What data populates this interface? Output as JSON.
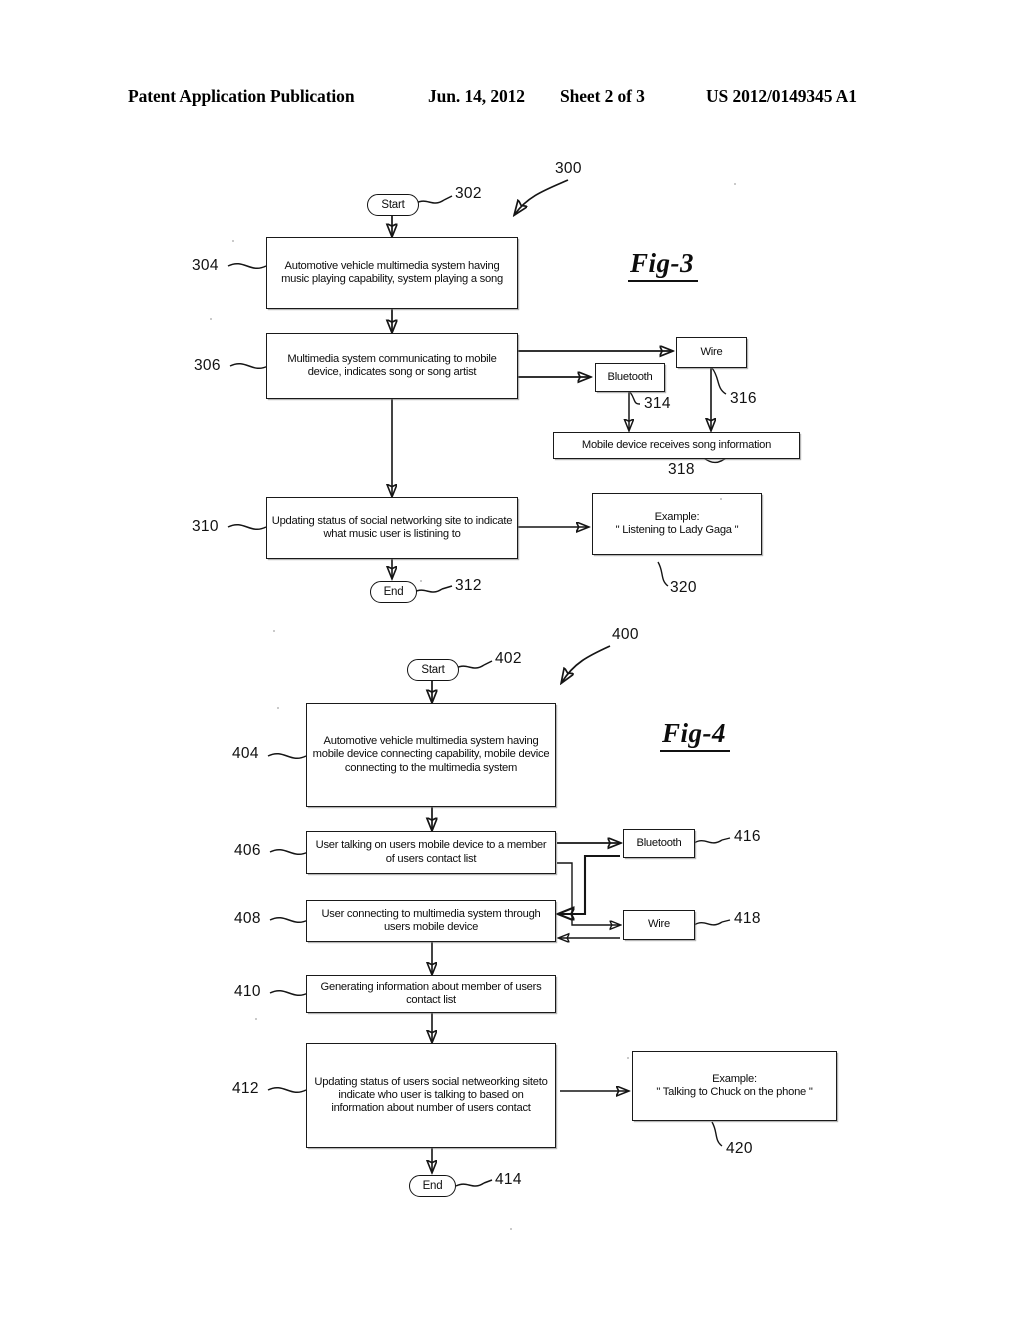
{
  "header": {
    "publication": "Patent Application Publication",
    "date": "Jun. 14, 2012",
    "sheet": "Sheet 2 of 3",
    "patent_number": "US 2012/0149345 A1"
  },
  "figures": [
    {
      "id": "fig-3",
      "label": "Fig-3",
      "diagram_ref": "300",
      "nodes": [
        {
          "ref": "302",
          "shape": "terminal",
          "text": "Start"
        },
        {
          "ref": "304",
          "shape": "process",
          "text": "Automotive vehicle multimedia system having music playing capability, system playing a song"
        },
        {
          "ref": "306",
          "shape": "process",
          "text": "Multimedia system communicating to mobile device, indicates song or song artist"
        },
        {
          "ref": "314",
          "shape": "process",
          "text": "Bluetooth"
        },
        {
          "ref": "316",
          "shape": "process",
          "text": "Wire"
        },
        {
          "ref": "318",
          "shape": "process",
          "text": "Mobile device receives song information"
        },
        {
          "ref": "310",
          "shape": "process",
          "text": "Updating status of social networking site to indicate what music user is listining to"
        },
        {
          "ref": "312",
          "shape": "terminal",
          "text": "End"
        },
        {
          "ref": "320",
          "shape": "process",
          "text": "Example: \" Listening to Lady Gaga \""
        }
      ]
    },
    {
      "id": "fig-4",
      "label": "Fig-4",
      "diagram_ref": "400",
      "nodes": [
        {
          "ref": "402",
          "shape": "terminal",
          "text": "Start"
        },
        {
          "ref": "404",
          "shape": "process",
          "text": "Automotive vehicle multimedia system having mobile device connecting capability, mobile device connecting to the multimedia system"
        },
        {
          "ref": "406",
          "shape": "process",
          "text": "User talking on users mobile device to a member of users contact list"
        },
        {
          "ref": "416",
          "shape": "process",
          "text": "Bluetooth"
        },
        {
          "ref": "408",
          "shape": "process",
          "text": "User connecting to multimedia system through users mobile device"
        },
        {
          "ref": "418",
          "shape": "process",
          "text": "Wire"
        },
        {
          "ref": "410",
          "shape": "process",
          "text": "Generating information about member of users contact list"
        },
        {
          "ref": "412",
          "shape": "process",
          "text": "Updating status of users social netweorking siteto indicate who user is talking to based on information about number of users contact"
        },
        {
          "ref": "414",
          "shape": "terminal",
          "text": "End"
        },
        {
          "ref": "420",
          "shape": "process",
          "text": "Example: \" Talking to Chuck on the phone \""
        }
      ]
    }
  ],
  "fig3": {
    "ref300": "300",
    "label": "Fig-3",
    "n302_text": "Start",
    "n302_ref": "302",
    "n304_text": "Automotive vehicle multimedia system having music playing capability, system playing a song",
    "n304_ref": "304",
    "n306_text": "Multimedia system communicating to mobile device, indicates song or song artist",
    "n306_ref": "306",
    "n314_text": "Bluetooth",
    "n314_ref": "314",
    "n316_text": "Wire",
    "n316_ref": "316",
    "n318_text": "Mobile device receives song information",
    "n318_ref": "318",
    "n310_text": "Updating status of social networking site to indicate what music user is listining to",
    "n310_ref": "310",
    "n312_text": "End",
    "n312_ref": "312",
    "n320_line1": "Example:",
    "n320_line2": "\" Listening to Lady Gaga \"",
    "n320_ref": "320"
  },
  "fig4": {
    "ref400": "400",
    "label": "Fig-4",
    "n402_text": "Start",
    "n402_ref": "402",
    "n404_text": "Automotive vehicle multimedia system having mobile device connecting capability, mobile device connecting to the multimedia system",
    "n404_ref": "404",
    "n406_text": "User talking on users mobile device to a member of users contact list",
    "n406_ref": "406",
    "n416_text": "Bluetooth",
    "n416_ref": "416",
    "n408_text": "User connecting to multimedia system through users mobile device",
    "n408_ref": "408",
    "n418_text": "Wire",
    "n418_ref": "418",
    "n410_text": "Generating information about member of users contact list",
    "n410_ref": "410",
    "n412_text": "Updating status of users social netweorking siteto indicate who user is talking to based on information about number of users contact",
    "n412_ref": "412",
    "n414_text": "End",
    "n414_ref": "414",
    "n420_line1": "Example:",
    "n420_line2": "\" Talking to Chuck on the phone \"",
    "n420_ref": "420"
  },
  "colors": {
    "ink": "#151515",
    "paper": "#ffffff"
  }
}
